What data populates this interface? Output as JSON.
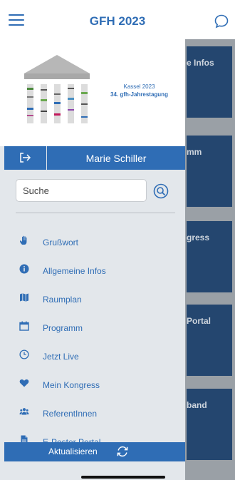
{
  "header": {
    "title": "GFH 2023",
    "menu_icon": "hamburger-icon",
    "chat_icon": "chat-bubble-icon"
  },
  "background_tiles": [
    {
      "label": "e Infos"
    },
    {
      "label": "mm"
    },
    {
      "label": "gress"
    },
    {
      "label": "Portal"
    },
    {
      "label": "band"
    }
  ],
  "logo": {
    "city": "Kassel 2023",
    "event": "34. gfh-Jahrestagung"
  },
  "user": {
    "name": "Marie Schiller",
    "logout_icon": "logout-icon"
  },
  "search": {
    "placeholder": "Suche",
    "icon": "search-icon"
  },
  "menu": [
    {
      "label": "Grußwort",
      "icon": "hand-icon"
    },
    {
      "label": "Allgemeine Infos",
      "icon": "info-icon"
    },
    {
      "label": "Raumplan",
      "icon": "map-icon"
    },
    {
      "label": "Programm",
      "icon": "calendar-icon"
    },
    {
      "label": "Jetzt Live",
      "icon": "clock-icon"
    },
    {
      "label": "Mein Kongress",
      "icon": "heart-icon"
    },
    {
      "label": "ReferentInnen",
      "icon": "people-icon"
    },
    {
      "label": "E-Poster Portal",
      "icon": "document-icon"
    }
  ],
  "refresh": {
    "label": "Aktualisieren",
    "icon": "refresh-icon"
  },
  "colors": {
    "accent": "#2f6db5",
    "drawer_bg": "#e3e7eb",
    "tile_bg": "#24466f"
  }
}
